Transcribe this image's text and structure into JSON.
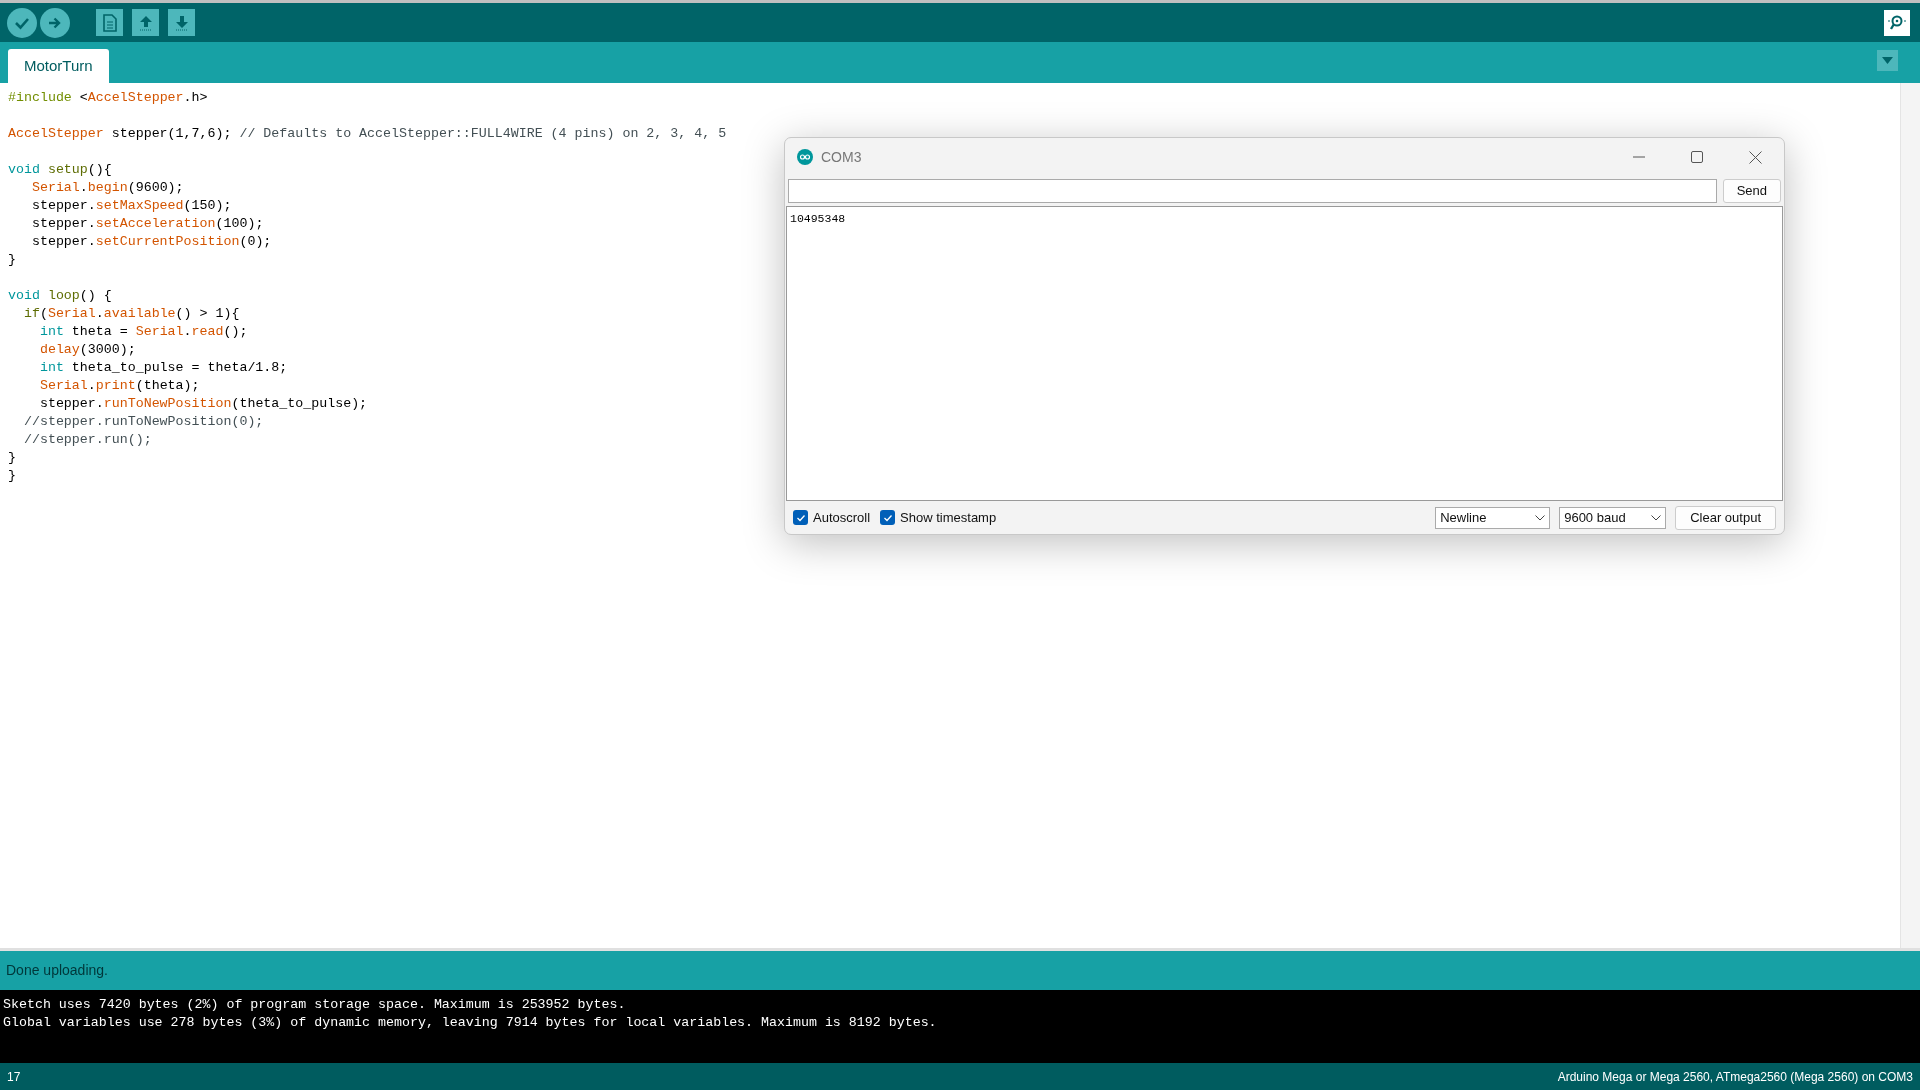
{
  "tabs": [
    {
      "label": "MotorTurn",
      "selected": true
    }
  ],
  "editor": {
    "lines": [
      {
        "kind": "code",
        "tokens": [
          {
            "kind": "pre",
            "t": "#include"
          },
          {
            "kind": "plain",
            "t": " <"
          },
          {
            "kind": "lib",
            "t": "AccelStepper"
          },
          {
            "kind": "plain",
            "t": ".h>"
          }
        ]
      },
      {
        "kind": "blank"
      },
      {
        "kind": "code",
        "tokens": [
          {
            "kind": "lib",
            "t": "AccelStepper"
          },
          {
            "kind": "plain",
            "t": " stepper(1,7,6); "
          },
          {
            "kind": "comment",
            "t": "// Defaults to AccelStepper::FULL4WIRE (4 pins) on 2, 3, 4, 5"
          }
        ]
      },
      {
        "kind": "blank"
      },
      {
        "kind": "code",
        "tokens": [
          {
            "kind": "kw",
            "t": "void"
          },
          {
            "kind": "fn",
            "t": " setup"
          },
          {
            "kind": "plain",
            "t": "(){"
          }
        ]
      },
      {
        "kind": "code",
        "tokens": [
          {
            "kind": "lib",
            "t": "   Serial"
          },
          {
            "kind": "plain",
            "t": "."
          },
          {
            "kind": "lib",
            "t": "begin"
          },
          {
            "kind": "plain",
            "t": "(9600);"
          }
        ]
      },
      {
        "kind": "code",
        "tokens": [
          {
            "kind": "plain",
            "t": "   stepper."
          },
          {
            "kind": "lib",
            "t": "setMaxSpeed"
          },
          {
            "kind": "plain",
            "t": "(150);"
          }
        ]
      },
      {
        "kind": "code",
        "tokens": [
          {
            "kind": "plain",
            "t": "   stepper."
          },
          {
            "kind": "lib",
            "t": "setAcceleration"
          },
          {
            "kind": "plain",
            "t": "(100);"
          }
        ]
      },
      {
        "kind": "code",
        "tokens": [
          {
            "kind": "plain",
            "t": "   stepper."
          },
          {
            "kind": "lib",
            "t": "setCurrentPosition"
          },
          {
            "kind": "plain",
            "t": "(0);"
          }
        ]
      },
      {
        "kind": "code",
        "tokens": [
          {
            "kind": "plain",
            "t": "}"
          }
        ]
      },
      {
        "kind": "blank"
      },
      {
        "kind": "code",
        "tokens": [
          {
            "kind": "kw",
            "t": "void"
          },
          {
            "kind": "fn",
            "t": " loop"
          },
          {
            "kind": "plain",
            "t": "() {"
          }
        ]
      },
      {
        "kind": "code",
        "tokens": [
          {
            "kind": "fn",
            "t": "  if"
          },
          {
            "kind": "plain",
            "t": "("
          },
          {
            "kind": "lib",
            "t": "Serial"
          },
          {
            "kind": "plain",
            "t": "."
          },
          {
            "kind": "lib",
            "t": "available"
          },
          {
            "kind": "plain",
            "t": "() > 1){"
          }
        ]
      },
      {
        "kind": "code",
        "tokens": [
          {
            "kind": "kw",
            "t": "    int"
          },
          {
            "kind": "plain",
            "t": " theta = "
          },
          {
            "kind": "lib",
            "t": "Serial"
          },
          {
            "kind": "plain",
            "t": "."
          },
          {
            "kind": "lib",
            "t": "read"
          },
          {
            "kind": "plain",
            "t": "();"
          }
        ]
      },
      {
        "kind": "code",
        "tokens": [
          {
            "kind": "lib",
            "t": "    delay"
          },
          {
            "kind": "plain",
            "t": "(3000);"
          }
        ]
      },
      {
        "kind": "code",
        "tokens": [
          {
            "kind": "kw",
            "t": "    int"
          },
          {
            "kind": "plain",
            "t": " theta_to_pulse = theta/1.8;"
          }
        ]
      },
      {
        "kind": "code",
        "tokens": [
          {
            "kind": "lib",
            "t": "    Serial"
          },
          {
            "kind": "plain",
            "t": "."
          },
          {
            "kind": "lib",
            "t": "print"
          },
          {
            "kind": "plain",
            "t": "(theta);"
          }
        ]
      },
      {
        "kind": "code",
        "tokens": [
          {
            "kind": "plain",
            "t": "    stepper."
          },
          {
            "kind": "lib",
            "t": "runToNewPosition"
          },
          {
            "kind": "plain",
            "t": "(theta_to_pulse);"
          }
        ]
      },
      {
        "kind": "code",
        "tokens": [
          {
            "kind": "comment",
            "t": "  //stepper.runToNewPosition(0);"
          }
        ]
      },
      {
        "kind": "code",
        "tokens": [
          {
            "kind": "comment",
            "t": "  //stepper.run();"
          }
        ]
      },
      {
        "kind": "code",
        "tokens": [
          {
            "kind": "plain",
            "t": "}"
          }
        ]
      },
      {
        "kind": "code",
        "tokens": [
          {
            "kind": "plain",
            "t": "}"
          }
        ]
      }
    ]
  },
  "serial_monitor": {
    "title": "COM3",
    "send": "Send",
    "output": [
      "10495348"
    ],
    "options": [
      {
        "label": "Autoscroll",
        "checked": true
      },
      {
        "label": "Show timestamp",
        "checked": true
      }
    ],
    "line_ending": "Newline",
    "baud": "9600 baud",
    "clear": "Clear output"
  },
  "status": "Done uploading.",
  "console": [
    "Sketch uses 7420 bytes (2%) of program storage space. Maximum is 253952 bytes.",
    "Global variables use 278 bytes (3%) of dynamic memory, leaving 7914 bytes for local variables. Maximum is 8192 bytes."
  ],
  "status_bar": {
    "line": "17",
    "board": "Arduino Mega or Mega 2560, ATmega2560 (Mega 2560) on COM3"
  }
}
